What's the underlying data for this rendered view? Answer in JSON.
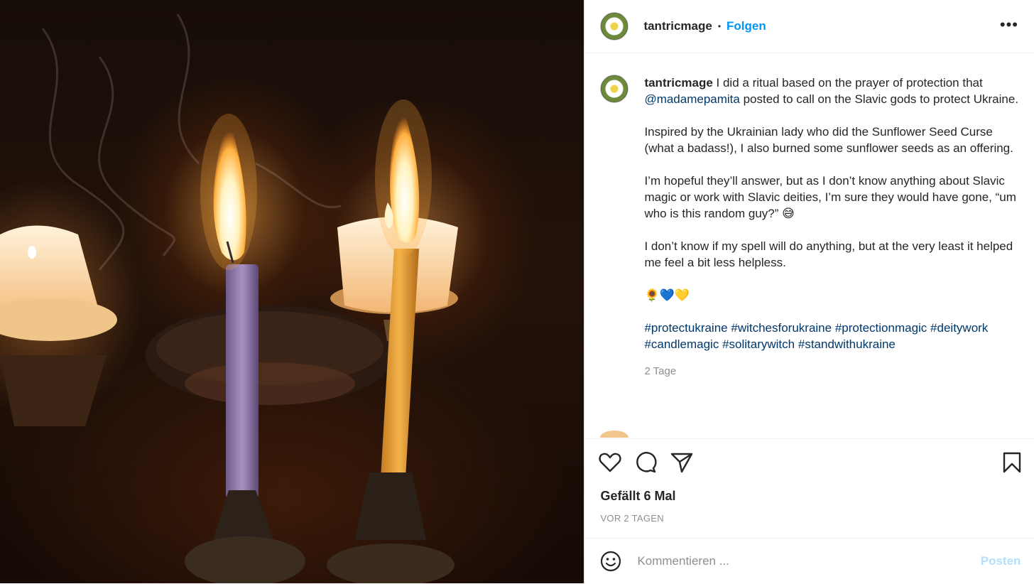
{
  "header": {
    "username": "tantricmage",
    "separator": "•",
    "follow_label": "Folgen",
    "more_label": "•••"
  },
  "caption": {
    "username": "tantricmage",
    "p1_a": " I did a ritual based on the prayer of protection that ",
    "mention": "@madamepamita",
    "p1_b": " posted to call on the Slavic gods to protect Ukraine.",
    "p2": "Inspired by the Ukrainian lady who did the Sunflower Seed Curse (what a badass!), I also burned some sunflower seeds as an offering.",
    "p3": "I’m hopeful they’ll answer, but as I don’t know anything about Slavic magic or work with Slavic deities, I’m sure they would have gone, “um who is this random guy?” 😅",
    "p4": "I don’t know if my spell will do anything, but at the very least it helped me feel a bit less helpless.",
    "emojis": "🌻💙💛",
    "hashtags": [
      "#protectukraine",
      "#witchesforukraine",
      "#protectionmagic",
      "#deitywork",
      "#candlemagic",
      "#solitarywitch",
      "#standwithukraine"
    ],
    "time": "2 Tage"
  },
  "actions": {
    "likes": "Gefällt 6 Mal",
    "ago": "VOR 2 TAGEN"
  },
  "comment": {
    "placeholder": "Kommentieren ...",
    "post_label": "Posten"
  },
  "icons": {
    "like": "heart-icon",
    "comment": "comment-bubble-icon",
    "share": "paper-plane-icon",
    "save": "bookmark-icon",
    "emoji": "smiley-icon",
    "more": "more-dots-icon"
  },
  "colors": {
    "follow": "#0095f6",
    "link": "#00376b",
    "post_disabled": "#b2dffc",
    "muted": "#8e8e8e"
  }
}
